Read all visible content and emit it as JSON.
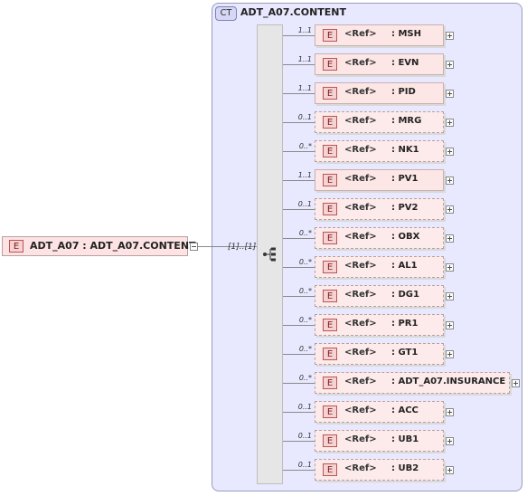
{
  "complex_type": {
    "tag": "CT",
    "title": "ADT_A07.CONTENT"
  },
  "root_element": {
    "tag": "E",
    "label": "ADT_A07 : ADT_A07.CONTENT",
    "occurrence": "[1]..[1]"
  },
  "ref_label": "<Ref>",
  "children": [
    {
      "tag": "E",
      "occurrence": "1..1",
      "name": ": MSH",
      "optional": false
    },
    {
      "tag": "E",
      "occurrence": "1..1",
      "name": ": EVN",
      "optional": false
    },
    {
      "tag": "E",
      "occurrence": "1..1",
      "name": ": PID",
      "optional": false
    },
    {
      "tag": "E",
      "occurrence": "0..1",
      "name": ": MRG",
      "optional": true
    },
    {
      "tag": "E",
      "occurrence": "0..*",
      "name": ": NK1",
      "optional": true
    },
    {
      "tag": "E",
      "occurrence": "1..1",
      "name": ": PV1",
      "optional": false
    },
    {
      "tag": "E",
      "occurrence": "0..1",
      "name": ": PV2",
      "optional": true
    },
    {
      "tag": "E",
      "occurrence": "0..*",
      "name": ": OBX",
      "optional": true
    },
    {
      "tag": "E",
      "occurrence": "0..*",
      "name": ": AL1",
      "optional": true
    },
    {
      "tag": "E",
      "occurrence": "0..*",
      "name": ": DG1",
      "optional": true
    },
    {
      "tag": "E",
      "occurrence": "0..*",
      "name": ": PR1",
      "optional": true
    },
    {
      "tag": "E",
      "occurrence": "0..*",
      "name": ": GT1",
      "optional": true
    },
    {
      "tag": "E",
      "occurrence": "0..*",
      "name": ": ADT_A07.INSURANCE",
      "optional": true
    },
    {
      "tag": "E",
      "occurrence": "0..1",
      "name": ": ACC",
      "optional": true
    },
    {
      "tag": "E",
      "occurrence": "0..1",
      "name": ": UB1",
      "optional": true
    },
    {
      "tag": "E",
      "occurrence": "0..1",
      "name": ": UB2",
      "optional": true
    }
  ]
}
